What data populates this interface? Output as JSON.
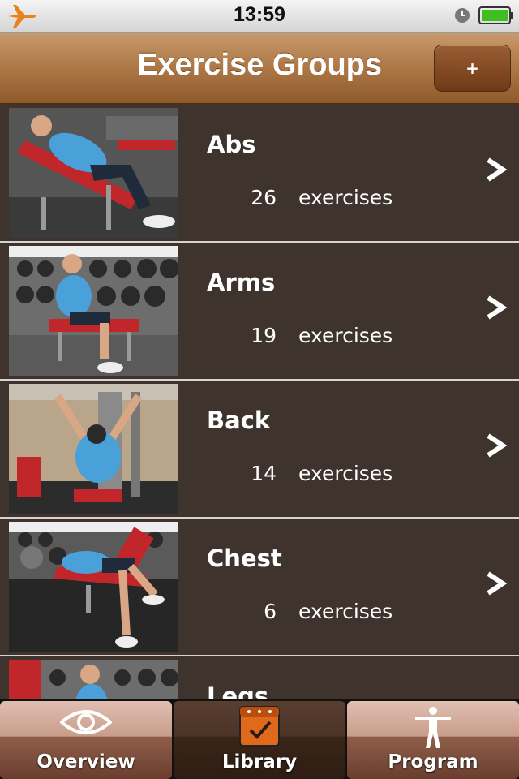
{
  "status_bar": {
    "time": "13:59"
  },
  "nav": {
    "title": "Exercise Groups",
    "add_label": "+"
  },
  "groups": [
    {
      "name": "Abs",
      "count": "26",
      "unit": "exercises"
    },
    {
      "name": "Arms",
      "count": "19",
      "unit": "exercises"
    },
    {
      "name": "Back",
      "count": "14",
      "unit": "exercises"
    },
    {
      "name": "Chest",
      "count": "6",
      "unit": "exercises"
    },
    {
      "name": "Legs",
      "count": "",
      "unit": ""
    }
  ],
  "tabs": [
    {
      "label": "Overview",
      "icon": "eye-icon",
      "selected": false
    },
    {
      "label": "Library",
      "icon": "checked-calendar-icon",
      "selected": true
    },
    {
      "label": "Program",
      "icon": "person-icon",
      "selected": false
    }
  ],
  "colors": {
    "nav_brown": "#b07a48",
    "list_bg": "#3e342d",
    "accent_orange": "#e06a1c",
    "shirt_blue": "#4aa0d8"
  }
}
